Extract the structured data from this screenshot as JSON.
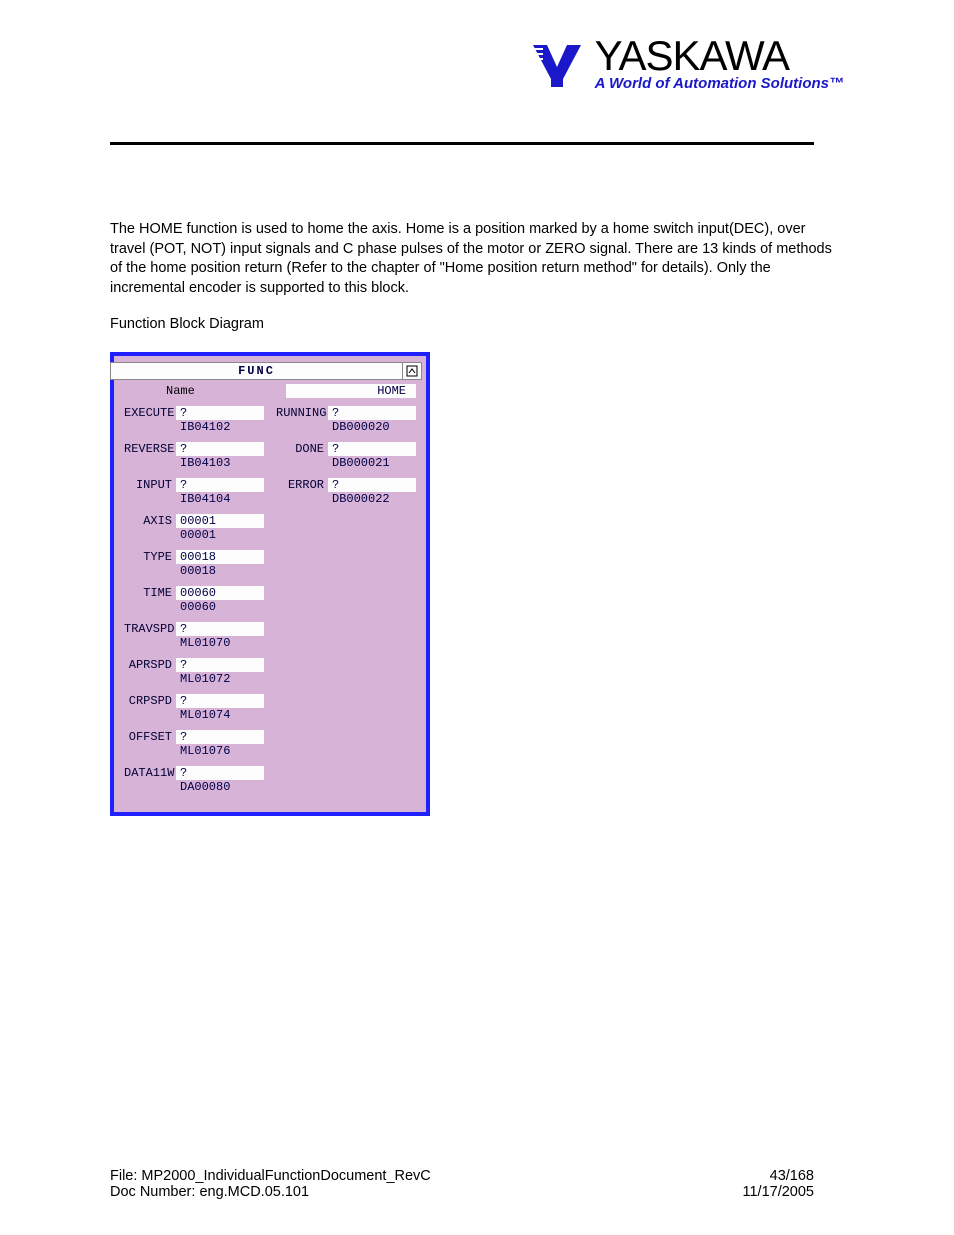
{
  "logo": {
    "name": "YASKAWA",
    "tagline": "A World of Automation Solutions™"
  },
  "body": {
    "para": "The HOME function is used to home the axis.  Home is a position marked by a home switch input(DEC), over travel (POT, NOT) input signals and C phase pulses of the motor or ZERO signal.  There are 13 kinds of methods of the home position return (Refer to the chapter of \"Home position return method\" for details).  Only the incremental encoder is supported to this block.",
    "section_label": "Function Block Diagram"
  },
  "fb": {
    "title": "FUNC",
    "name_label": "Name",
    "name_value": "HOME",
    "rows": [
      {
        "l": {
          "label": "EXECUTE",
          "top": "?",
          "bot": "IB04102"
        },
        "r": {
          "label": "RUNNING",
          "top": "?",
          "bot": "DB000020"
        }
      },
      {
        "l": {
          "label": "REVERSE",
          "top": "?",
          "bot": "IB04103"
        },
        "r": {
          "label": "DONE",
          "top": "?",
          "bot": "DB000021"
        }
      },
      {
        "l": {
          "label": "INPUT",
          "top": "?",
          "bot": "IB04104"
        },
        "r": {
          "label": "ERROR",
          "top": "?",
          "bot": "DB000022"
        }
      },
      {
        "l": {
          "label": "AXIS",
          "top": "00001",
          "bot": "00001"
        }
      },
      {
        "l": {
          "label": "TYPE",
          "top": "00018",
          "bot": "00018"
        }
      },
      {
        "l": {
          "label": "TIME",
          "top": "00060",
          "bot": "00060"
        }
      },
      {
        "l": {
          "label": "TRAVSPD",
          "top": "?",
          "bot": "ML01070"
        }
      },
      {
        "l": {
          "label": "APRSPD",
          "top": "?",
          "bot": "ML01072"
        }
      },
      {
        "l": {
          "label": "CRPSPD",
          "top": "?",
          "bot": "ML01074"
        }
      },
      {
        "l": {
          "label": "OFFSET",
          "top": "?",
          "bot": "ML01076"
        }
      },
      {
        "l": {
          "label": "DATA11W",
          "top": "?",
          "bot": "DA00080"
        }
      }
    ]
  },
  "footer": {
    "file_label": "File:  MP2000_IndividualFunctionDocument_RevC",
    "doc_label": "Doc Number:  eng.MCD.05.101",
    "page": "43/168",
    "date": "11/17/2005"
  }
}
